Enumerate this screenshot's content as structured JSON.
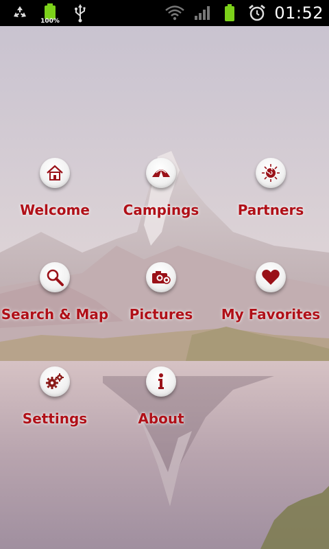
{
  "status_bar": {
    "battery_percent": "100%",
    "time": "01:52"
  },
  "colors": {
    "accent": "#b01018",
    "status_bar_bg": "#000000",
    "battery_green": "#7cd11a"
  },
  "menu": {
    "items": [
      {
        "label": "Welcome",
        "icon": "home-icon"
      },
      {
        "label": "Campings",
        "icon": "tent-icon"
      },
      {
        "label": "Partners",
        "icon": "sun-spiral-icon"
      },
      {
        "label": "Search & Map",
        "icon": "magnifier-icon"
      },
      {
        "label": "Pictures",
        "icon": "camera-icon"
      },
      {
        "label": "My Favorites",
        "icon": "heart-icon"
      },
      {
        "label": "Settings",
        "icon": "gears-icon"
      },
      {
        "label": "About",
        "icon": "info-icon"
      }
    ]
  }
}
